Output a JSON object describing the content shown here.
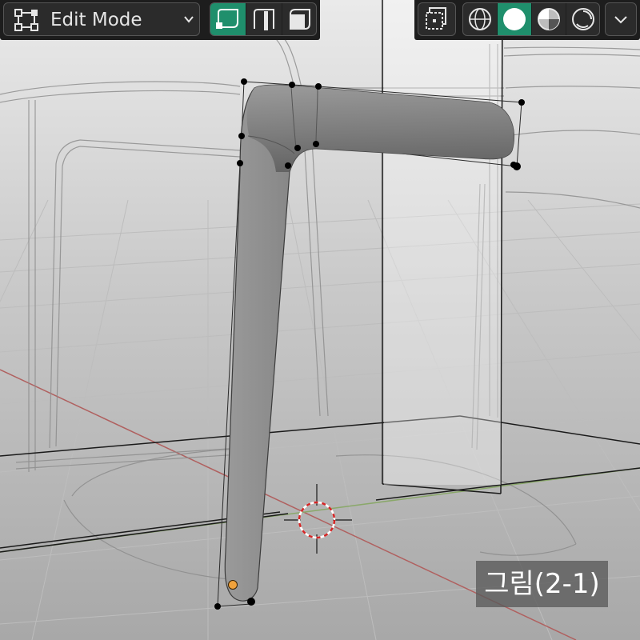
{
  "header": {
    "mode_selector": {
      "label": "Edit Mode",
      "icon": "edit-mode-icon"
    },
    "select_mode_buttons": [
      {
        "name": "vertex-select",
        "icon": "vertex-select-icon",
        "active": true
      },
      {
        "name": "edge-select",
        "icon": "edge-select-icon",
        "active": false
      },
      {
        "name": "face-select",
        "icon": "face-select-icon",
        "active": false
      }
    ],
    "xray_toggle": {
      "icon": "xray-icon",
      "active": false
    },
    "shading_buttons": [
      {
        "name": "wireframe",
        "icon": "wireframe-shading-icon",
        "active": false
      },
      {
        "name": "solid",
        "icon": "solid-shading-icon",
        "active": true
      },
      {
        "name": "material-preview",
        "icon": "material-preview-icon",
        "active": false
      },
      {
        "name": "rendered",
        "icon": "rendered-shading-icon",
        "active": false
      }
    ],
    "shading_menu": {
      "icon": "chevron-down-icon"
    }
  },
  "caption": {
    "text": "그림(2-1)"
  },
  "colors": {
    "header_bg": "#1d1d1d",
    "button_bg": "#2b2b2b",
    "active": "#1f8f6c",
    "viewport_bg": "#d9d9d9",
    "mesh": "#808080",
    "axis_x": "#b0605f",
    "axis_y": "#8aa86a",
    "cursor": "#d42525",
    "vertex": "#000000",
    "selected_vertex": "#f0a23c"
  }
}
